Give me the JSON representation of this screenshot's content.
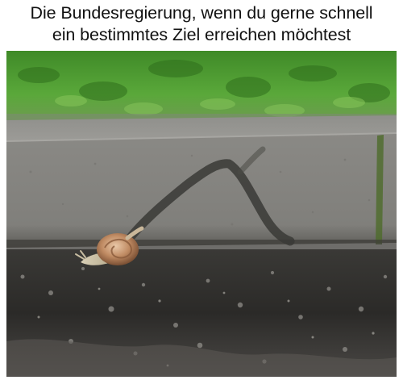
{
  "caption": {
    "line1": "Die Bundesregierung, wenn du gerne schnell",
    "line2": "ein bestimmtes Ziel erreichen möchtest"
  },
  "photo": {
    "subject": "snail-icon",
    "colors": {
      "grass": "#4f9a32",
      "curb": "#8c8c88",
      "asphalt": "#2b2a28",
      "slime_trail": "#3a3a36",
      "shell": "#b07a58"
    }
  }
}
